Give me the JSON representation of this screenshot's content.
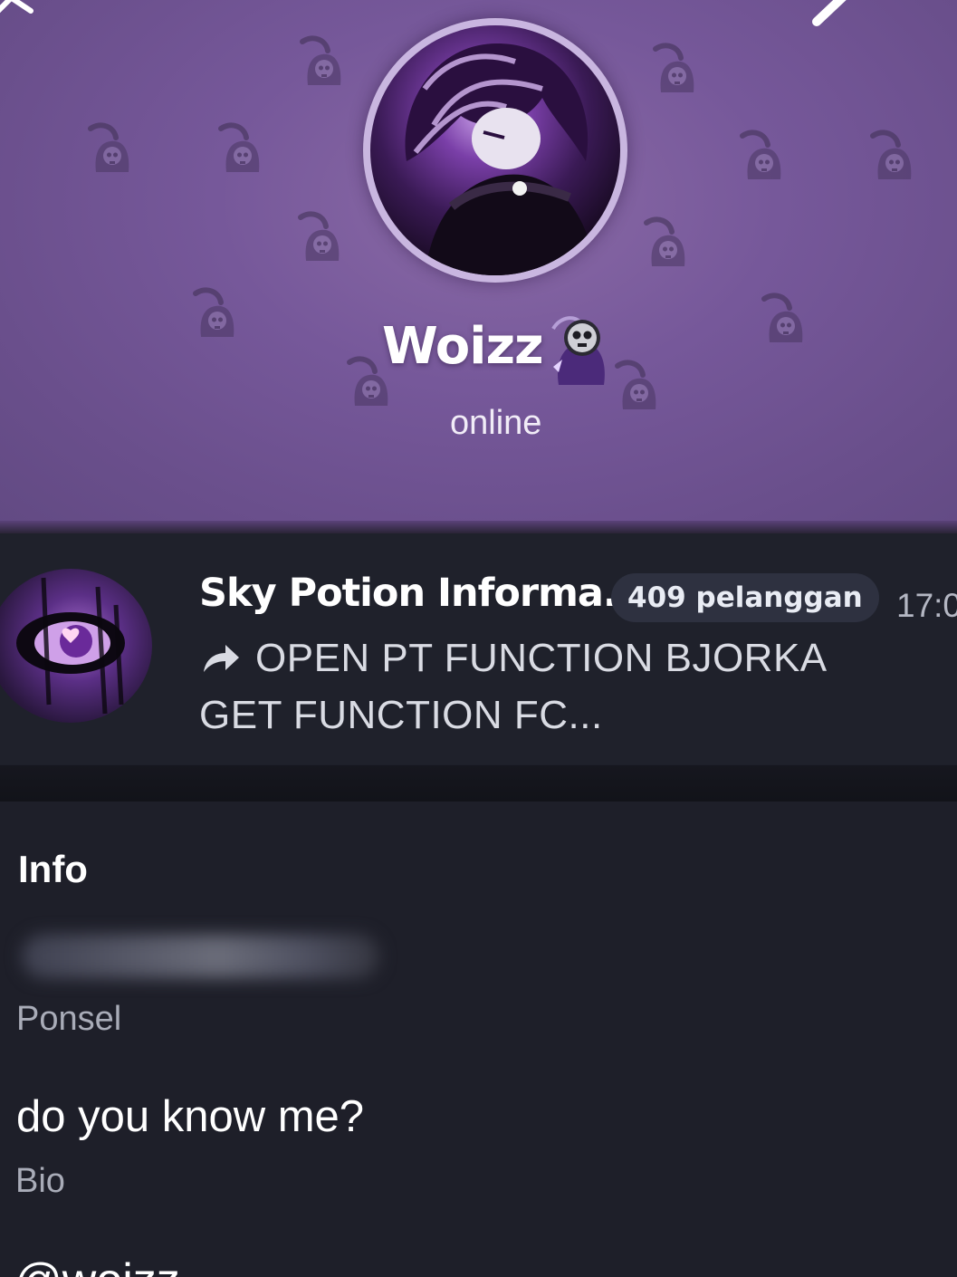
{
  "profile": {
    "name": "Woizz",
    "status": "online",
    "accent_color": "#76589a"
  },
  "channel": {
    "title": "Sky Potion Informa...",
    "subscribers_badge": "409 pelanggan",
    "time": "17:0",
    "preview_line1": "OPEN PT FUNCTION BJORKA",
    "preview_line2": "GET FUNCTION FC..."
  },
  "info": {
    "section_title": "Info",
    "phone_label": "Ponsel",
    "bio": "do you know me?",
    "bio_label": "Bio",
    "username_partial": "@woizz"
  },
  "icons": {
    "top_left": "close-icon",
    "top_right": "edit-icon",
    "forward": "forward-arrow-icon",
    "pattern": "reaper-skull-icon"
  },
  "colors": {
    "header_bg": "#76589a",
    "page_bg": "#1e1f29",
    "badge_bg": "#2e3140",
    "muted_text": "#a9acb8"
  }
}
